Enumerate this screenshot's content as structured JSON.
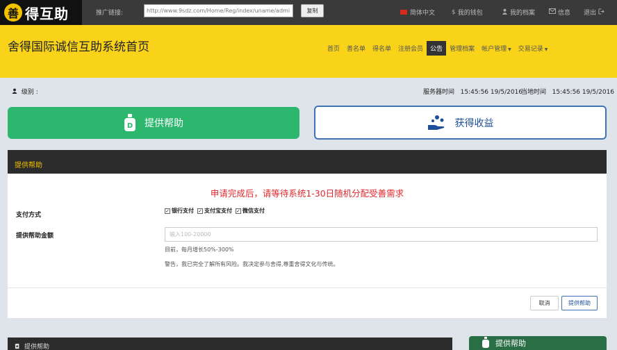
{
  "topbar": {
    "logo_mark": "善",
    "logo_text": "得互助",
    "promo_label": "推广链接:",
    "promo_url": "http://www.9sdz.com/Home/Reg/index/uname/admi",
    "copy_label": "复制",
    "nav": [
      {
        "label": "简体中文",
        "icon": "china-flag-icon"
      },
      {
        "label": "我的钱包",
        "icon": "dollar-icon"
      },
      {
        "label": "我的档案",
        "icon": "user-icon"
      },
      {
        "label": "信息",
        "icon": "envelope-icon"
      },
      {
        "label": "退出",
        "icon": "logout-icon"
      }
    ]
  },
  "header": {
    "site_title": "舍得国际诚信互助系统首页",
    "nav": [
      {
        "label": "首页",
        "active": false
      },
      {
        "label": "善名单",
        "active": false
      },
      {
        "label": "得名单",
        "active": false
      },
      {
        "label": "注册会员",
        "active": false
      },
      {
        "label": "公告",
        "active": true
      },
      {
        "label": "管理档案",
        "active": false
      },
      {
        "label": "帐户管理",
        "active": false,
        "dropdown": true
      },
      {
        "label": "交易记录",
        "active": false,
        "dropdown": true
      }
    ]
  },
  "status": {
    "level_label": "级别 :",
    "server_time_label": "服务器时间",
    "server_time": "15:45:56 19/5/2016",
    "local_time_label": "当地时间",
    "local_time": "15:45:56 19/5/2016"
  },
  "actions": {
    "provide_help": "提供帮助",
    "get_benefit": "获得收益"
  },
  "panel": {
    "title": "提供帮助",
    "notice": "申请完成后，请等待系统1-30日随机分配受善需求",
    "payment_label": "支付方式",
    "payments": [
      "银行支付",
      "支付宝支付",
      "微信支付"
    ],
    "amount_label": "提供帮助金额",
    "amount_placeholder": "输入100-20000",
    "hint1": "目前，每月增长50%-300%",
    "hint2": "警告，我已完全了解所有风险。我决定参与舍得,尊重舍得文化与传统。",
    "cancel_label": "取消",
    "submit_label": "提供帮助"
  },
  "bottom": {
    "left_title": "提供帮助",
    "right_title": "提供帮助"
  },
  "colors": {
    "header_yellow": "#f8d31a",
    "green": "#2db66e",
    "blue": "#3e73b8",
    "notice_red": "#e0272b",
    "dark": "#2b2b2b"
  }
}
